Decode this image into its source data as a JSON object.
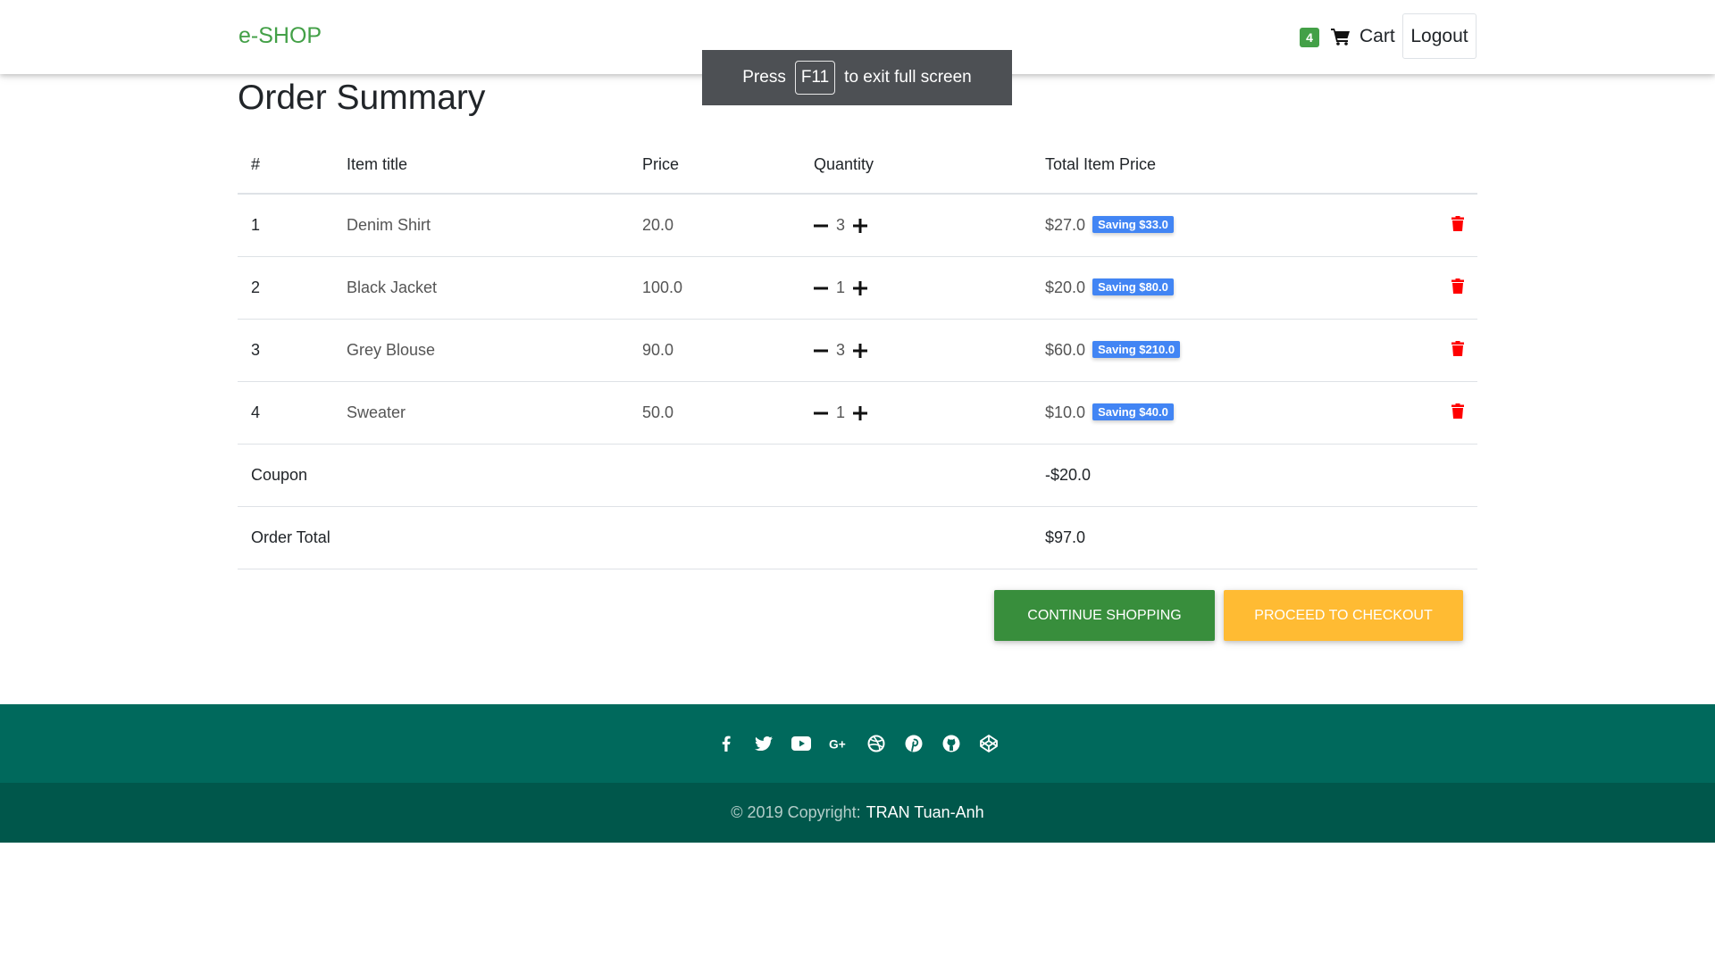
{
  "navbar": {
    "brand": "e-SHOP",
    "cart_count": "4",
    "cart_label": "Cart",
    "logout_label": "Logout"
  },
  "fullscreen_notice": {
    "prefix": "Press",
    "key": "F11",
    "suffix": "to exit full screen"
  },
  "page_title": "Order Summary",
  "table": {
    "headers": [
      "#",
      "Item title",
      "Price",
      "Quantity",
      "Total Item Price"
    ],
    "rows": [
      {
        "index": "1",
        "title": "Denim Shirt",
        "price": "20.0",
        "quantity": "3",
        "total": "$27.0",
        "saving": "Saving $33.0"
      },
      {
        "index": "2",
        "title": "Black Jacket",
        "price": "100.0",
        "quantity": "1",
        "total": "$20.0",
        "saving": "Saving $80.0"
      },
      {
        "index": "3",
        "title": "Grey Blouse",
        "price": "90.0",
        "quantity": "3",
        "total": "$60.0",
        "saving": "Saving $210.0"
      },
      {
        "index": "4",
        "title": "Sweater",
        "price": "50.0",
        "quantity": "1",
        "total": "$10.0",
        "saving": "Saving $40.0"
      }
    ],
    "coupon": {
      "label": "Coupon",
      "value": "-$20.0"
    },
    "order_total": {
      "label": "Order Total",
      "value": "$97.0"
    }
  },
  "buttons": {
    "continue_shopping": "Continue shopping",
    "proceed_checkout": "Proceed to checkout"
  },
  "footer": {
    "social_icons": [
      "facebook-icon",
      "twitter-icon",
      "youtube-icon",
      "google-plus-icon",
      "dribbble-icon",
      "pinterest-icon",
      "github-icon",
      "codepen-icon"
    ],
    "copyright_prefix": "© 2019 Copyright:",
    "copyright_author": "TRAN Tuan-Anh"
  },
  "colors": {
    "brand": "#43a047",
    "continue_button": "#388e3c",
    "checkout_button": "#ffbb33",
    "saving_badge": "#4285f4",
    "trash_icon": "#ff0000",
    "footer_top": "#00695c",
    "footer_bottom": "#00574b"
  }
}
